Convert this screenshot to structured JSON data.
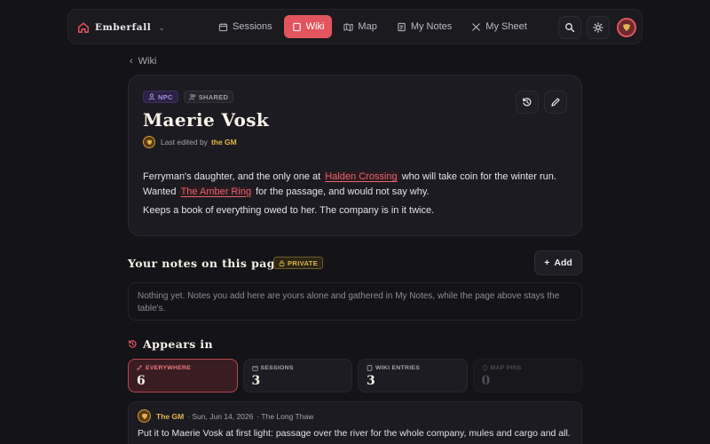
{
  "nav": {
    "brand": "Emberfall",
    "tabs": [
      {
        "label": "Sessions",
        "icon": "calendar-icon",
        "active": false
      },
      {
        "label": "Wiki",
        "icon": "book-icon",
        "active": true
      },
      {
        "label": "Map",
        "icon": "map-icon",
        "active": false
      },
      {
        "label": "My Notes",
        "icon": "notes-icon",
        "active": false
      },
      {
        "label": "My Sheet",
        "icon": "swords-icon",
        "active": false
      }
    ]
  },
  "breadcrumb": {
    "label": "Wiki"
  },
  "page": {
    "tags": [
      "NPC",
      "SHARED"
    ],
    "title": "Maerie Vosk",
    "edited_prefix": "Last edited by",
    "edited_by": "the GM",
    "body": {
      "p1_a": "Ferryman's daughter, and the only one at",
      "link1": "Halden Crossing",
      "p1_b": "who will take coin for the winter run.",
      "p1_c": "Wanted",
      "link2": "The Amber Ring",
      "p1_d": "for the passage, and would not say why.",
      "p2": "Keeps a book of everything owed to her. The company is in it twice."
    }
  },
  "notes": {
    "title": "Your notes on this page",
    "badge": "PRIVATE",
    "add_label": "Add",
    "empty": "Nothing yet. Notes you add here are yours alone and gathered in My Notes, while the page above stays the table's."
  },
  "appears": {
    "title": "Appears in",
    "stats": [
      {
        "label": "EVERYWHERE",
        "value": "6",
        "state": "active"
      },
      {
        "label": "SESSIONS",
        "value": "3",
        "state": "normal"
      },
      {
        "label": "WIKI ENTRIES",
        "value": "3",
        "state": "normal"
      },
      {
        "label": "MAP PINS",
        "value": "0",
        "state": "disabled"
      }
    ]
  },
  "activity": {
    "author": "The GM",
    "date": "· Sun, Jun 14, 2026",
    "session": "· The Long Thaw",
    "text": "Put it to Maerie Vosk at first light: passage over the river for the whole company, mules and cargo and all. Sh..."
  },
  "colors": {
    "accent": "#e3555e",
    "gold": "#e2b44d",
    "npc": "#a48ee0",
    "background": "#141317"
  }
}
